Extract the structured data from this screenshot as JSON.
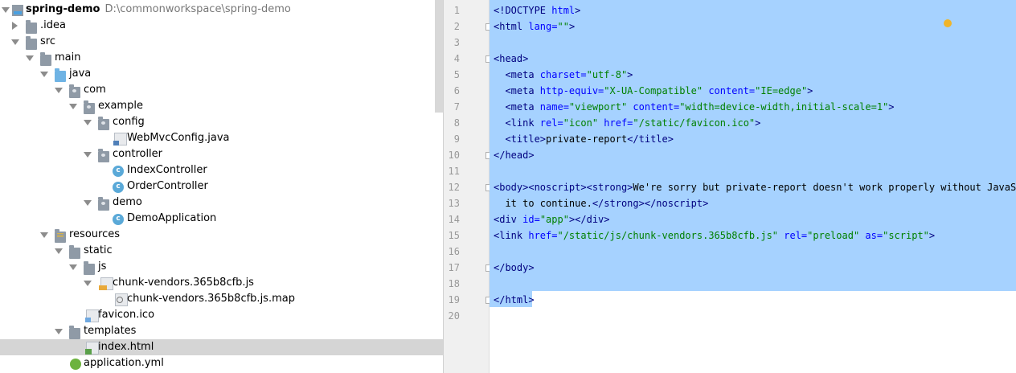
{
  "tree": {
    "project_name": "spring-demo",
    "project_path": "D:\\commonworkspace\\spring-demo",
    "items": [
      {
        "label": "spring-demo",
        "icon": "module-icon",
        "expanded": true
      },
      {
        "label": ".idea",
        "icon": "folder-icon",
        "expanded": false
      },
      {
        "label": "src",
        "icon": "folder-icon",
        "expanded": true
      },
      {
        "label": "main",
        "icon": "folder-icon",
        "expanded": true
      },
      {
        "label": "java",
        "icon": "source-folder-icon",
        "expanded": true
      },
      {
        "label": "com",
        "icon": "package-icon",
        "expanded": true
      },
      {
        "label": "example",
        "icon": "package-icon",
        "expanded": true
      },
      {
        "label": "config",
        "icon": "package-icon",
        "expanded": true
      },
      {
        "label": "WebMvcConfig.java",
        "icon": "java-file-icon"
      },
      {
        "label": "controller",
        "icon": "package-icon",
        "expanded": true
      },
      {
        "label": "IndexController",
        "icon": "class-icon"
      },
      {
        "label": "OrderController",
        "icon": "class-icon"
      },
      {
        "label": "demo",
        "icon": "package-icon",
        "expanded": true
      },
      {
        "label": "DemoApplication",
        "icon": "class-icon"
      },
      {
        "label": "resources",
        "icon": "resources-folder-icon",
        "expanded": true
      },
      {
        "label": "static",
        "icon": "folder-icon",
        "expanded": true
      },
      {
        "label": "js",
        "icon": "folder-icon",
        "expanded": true
      },
      {
        "label": "chunk-vendors.365b8cfb.js",
        "icon": "js-file-icon",
        "expanded": true
      },
      {
        "label": "chunk-vendors.365b8cfb.js.map",
        "icon": "map-file-icon"
      },
      {
        "label": "favicon.ico",
        "icon": "ico-file-icon"
      },
      {
        "label": "templates",
        "icon": "folder-icon",
        "expanded": true
      },
      {
        "label": "index.html",
        "icon": "html-file-icon",
        "selected": true
      },
      {
        "label": "application.yml",
        "icon": "yml-file-icon"
      }
    ]
  },
  "editor": {
    "line_numbers": [
      "1",
      "2",
      "3",
      "4",
      "5",
      "6",
      "7",
      "8",
      "9",
      "10",
      "11",
      "12",
      "13",
      "14",
      "15",
      "16",
      "17",
      "18",
      "19",
      "20"
    ],
    "lines": {
      "l1": {
        "a": "<!DOCTYPE ",
        "b": "html",
        "c": ">"
      },
      "l2": {
        "a": "<html ",
        "b": "lang=",
        "c": "\"\"",
        "d": ">"
      },
      "l4": {
        "a": "<head>"
      },
      "l5": {
        "a": "  <meta ",
        "b": "charset=",
        "c": "\"utf-8\"",
        "d": ">"
      },
      "l6": {
        "a": "  <meta ",
        "b": "http-equiv=",
        "c": "\"X-UA-Compatible\"",
        "d": " content=",
        "e": "\"IE=edge\"",
        "f": ">"
      },
      "l7": {
        "a": "  <meta ",
        "b": "name=",
        "c": "\"viewport\"",
        "d": " content=",
        "e": "\"width=device-width,initial-scale=1\"",
        "f": ">"
      },
      "l8": {
        "a": "  <link ",
        "b": "rel=",
        "c": "\"icon\"",
        "d": " href=",
        "e": "\"/static/favicon.ico\"",
        "f": ">"
      },
      "l9": {
        "a": "  <title>",
        "b": "private-report",
        "c": "</title>"
      },
      "l10": {
        "a": "</head>"
      },
      "l12": {
        "a": "<body><noscript><strong>",
        "b": "We're sorry but private-report doesn't work properly without JavaScri"
      },
      "l13": {
        "a": "  it to continue.",
        "b": "</strong></noscript>"
      },
      "l14": {
        "a": "<div ",
        "b": "id=",
        "c": "\"app\"",
        "d": "></div>"
      },
      "l15": {
        "a": "<link ",
        "b": "href=",
        "c": "\"/static/js/chunk-vendors.365b8cfb.js\"",
        "d": " rel=",
        "e": "\"preload\"",
        "f": " as=",
        "g": "\"script\"",
        "h": ">"
      },
      "l17": {
        "a": "</body>"
      },
      "l19": {
        "a": "</html>"
      }
    }
  }
}
